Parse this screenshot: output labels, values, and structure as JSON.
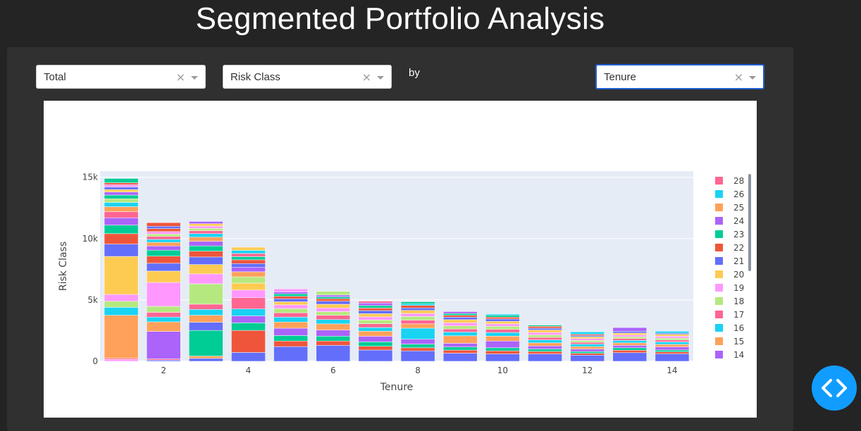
{
  "page": {
    "title": "Segmented Portfolio Analysis",
    "by_label": "by"
  },
  "controls": {
    "metric_dropdown": {
      "value": "Total",
      "clear": "×"
    },
    "segment_dropdown": {
      "value": "Risk Class",
      "clear": "×"
    },
    "groupby_dropdown": {
      "value": "Tenure",
      "clear": "×"
    }
  },
  "chart_data": {
    "type": "bar",
    "stacked": true,
    "xlabel": "Tenure",
    "ylabel": "Risk Class",
    "x": [
      1,
      2,
      3,
      4,
      5,
      6,
      7,
      8,
      9,
      10,
      11,
      12,
      13,
      14
    ],
    "x_ticks": [
      "2",
      "4",
      "6",
      "8",
      "10",
      "12",
      "14"
    ],
    "y_ticks": [
      "0",
      "5k",
      "10k",
      "15k"
    ],
    "ylim": [
      0,
      15500
    ],
    "grid": true,
    "legend_position": "right",
    "legend_entries": [
      {
        "name": "28",
        "color": "#FF6692"
      },
      {
        "name": "26",
        "color": "#19D3F3"
      },
      {
        "name": "25",
        "color": "#FFA15A"
      },
      {
        "name": "24",
        "color": "#AB63FA"
      },
      {
        "name": "23",
        "color": "#00CC96"
      },
      {
        "name": "22",
        "color": "#EF553B"
      },
      {
        "name": "21",
        "color": "#636EFA"
      },
      {
        "name": "20",
        "color": "#FECB52"
      },
      {
        "name": "19",
        "color": "#FF97FF"
      },
      {
        "name": "18",
        "color": "#B6E880"
      },
      {
        "name": "17",
        "color": "#FF6692"
      },
      {
        "name": "16",
        "color": "#19D3F3"
      },
      {
        "name": "15",
        "color": "#FFA15A"
      },
      {
        "name": "14",
        "color": "#AB63FA"
      }
    ],
    "totals": [
      14900,
      11300,
      11400,
      9300,
      5900,
      5700,
      4900,
      4850,
      4050,
      3850,
      2950,
      2400,
      2750,
      2450
    ],
    "segment_palette": [
      "#636EFA",
      "#EF553B",
      "#00CC96",
      "#AB63FA",
      "#FFA15A",
      "#19D3F3",
      "#FF6692",
      "#B6E880",
      "#FF97FF",
      "#FECB52"
    ],
    "segments": [
      [
        {
          "c": 8,
          "v": 150
        },
        {
          "c": 6,
          "v": 100
        },
        {
          "c": 4,
          "v": 3500
        },
        {
          "c": 5,
          "v": 650
        },
        {
          "c": 7,
          "v": 500
        },
        {
          "c": 8,
          "v": 550
        },
        {
          "c": 9,
          "v": 3100
        },
        {
          "c": 0,
          "v": 1000
        },
        {
          "c": 1,
          "v": 850
        },
        {
          "c": 2,
          "v": 700
        },
        {
          "c": 3,
          "v": 600
        },
        {
          "c": 6,
          "v": 500
        },
        {
          "c": 4,
          "v": 400
        },
        {
          "c": 5,
          "v": 350
        },
        {
          "c": 7,
          "v": 300
        },
        {
          "c": 2,
          "v": 300
        },
        {
          "c": 3,
          "v": 250
        },
        {
          "c": 9,
          "v": 200
        },
        {
          "c": 0,
          "v": 200
        },
        {
          "c": 8,
          "v": 200
        },
        {
          "c": 1,
          "v": 150
        },
        {
          "c": 2,
          "v": 350
        }
      ],
      [
        {
          "c": 0,
          "v": 100
        },
        {
          "c": 6,
          "v": 100
        },
        {
          "c": 3,
          "v": 2300
        },
        {
          "c": 4,
          "v": 800
        },
        {
          "c": 5,
          "v": 400
        },
        {
          "c": 6,
          "v": 400
        },
        {
          "c": 7,
          "v": 500
        },
        {
          "c": 8,
          "v": 2000
        },
        {
          "c": 9,
          "v": 950
        },
        {
          "c": 0,
          "v": 650
        },
        {
          "c": 1,
          "v": 600
        },
        {
          "c": 2,
          "v": 500
        },
        {
          "c": 3,
          "v": 350
        },
        {
          "c": 4,
          "v": 300
        },
        {
          "c": 5,
          "v": 250
        },
        {
          "c": 6,
          "v": 250
        },
        {
          "c": 7,
          "v": 200
        },
        {
          "c": 8,
          "v": 200
        },
        {
          "c": 1,
          "v": 250
        },
        {
          "c": 0,
          "v": 200
        },
        {
          "c": 1,
          "v": 300
        }
      ],
      [
        {
          "c": 0,
          "v": 250
        },
        {
          "c": 4,
          "v": 200
        },
        {
          "c": 2,
          "v": 2200
        },
        {
          "c": 0,
          "v": 700
        },
        {
          "c": 4,
          "v": 600
        },
        {
          "c": 5,
          "v": 500
        },
        {
          "c": 6,
          "v": 450
        },
        {
          "c": 7,
          "v": 1750
        },
        {
          "c": 8,
          "v": 850
        },
        {
          "c": 9,
          "v": 800
        },
        {
          "c": 0,
          "v": 650
        },
        {
          "c": 1,
          "v": 500
        },
        {
          "c": 2,
          "v": 450
        },
        {
          "c": 3,
          "v": 400
        },
        {
          "c": 4,
          "v": 350
        },
        {
          "c": 5,
          "v": 300
        },
        {
          "c": 6,
          "v": 250
        },
        {
          "c": 7,
          "v": 200
        },
        {
          "c": 8,
          "v": 200
        },
        {
          "c": 9,
          "v": 200
        },
        {
          "c": 3,
          "v": 200
        }
      ],
      [
        {
          "c": 0,
          "v": 700
        },
        {
          "c": 1,
          "v": 1750
        },
        {
          "c": 2,
          "v": 600
        },
        {
          "c": 3,
          "v": 550
        },
        {
          "c": 5,
          "v": 550
        },
        {
          "c": 6,
          "v": 900
        },
        {
          "c": 8,
          "v": 600
        },
        {
          "c": 9,
          "v": 550
        },
        {
          "c": 7,
          "v": 500
        },
        {
          "c": 4,
          "v": 400
        },
        {
          "c": 3,
          "v": 350
        },
        {
          "c": 0,
          "v": 300
        },
        {
          "c": 1,
          "v": 300
        },
        {
          "c": 2,
          "v": 250
        },
        {
          "c": 6,
          "v": 250
        },
        {
          "c": 5,
          "v": 250
        },
        {
          "c": 9,
          "v": 250
        }
      ],
      [
        {
          "c": 0,
          "v": 1200
        },
        {
          "c": 1,
          "v": 450
        },
        {
          "c": 2,
          "v": 450
        },
        {
          "c": 3,
          "v": 600
        },
        {
          "c": 4,
          "v": 500
        },
        {
          "c": 5,
          "v": 400
        },
        {
          "c": 6,
          "v": 350
        },
        {
          "c": 7,
          "v": 350
        },
        {
          "c": 8,
          "v": 300
        },
        {
          "c": 9,
          "v": 250
        },
        {
          "c": 0,
          "v": 250
        },
        {
          "c": 1,
          "v": 200
        },
        {
          "c": 2,
          "v": 200
        },
        {
          "c": 3,
          "v": 150
        },
        {
          "c": 8,
          "v": 250
        }
      ],
      [
        {
          "c": 0,
          "v": 1300
        },
        {
          "c": 1,
          "v": 350
        },
        {
          "c": 2,
          "v": 400
        },
        {
          "c": 3,
          "v": 500
        },
        {
          "c": 4,
          "v": 500
        },
        {
          "c": 5,
          "v": 350
        },
        {
          "c": 6,
          "v": 350
        },
        {
          "c": 7,
          "v": 300
        },
        {
          "c": 8,
          "v": 300
        },
        {
          "c": 9,
          "v": 300
        },
        {
          "c": 0,
          "v": 250
        },
        {
          "c": 1,
          "v": 200
        },
        {
          "c": 2,
          "v": 150
        },
        {
          "c": 3,
          "v": 150
        },
        {
          "c": 7,
          "v": 300
        }
      ],
      [
        {
          "c": 0,
          "v": 900
        },
        {
          "c": 1,
          "v": 300
        },
        {
          "c": 2,
          "v": 350
        },
        {
          "c": 3,
          "v": 450
        },
        {
          "c": 4,
          "v": 400
        },
        {
          "c": 5,
          "v": 300
        },
        {
          "c": 6,
          "v": 300
        },
        {
          "c": 7,
          "v": 300
        },
        {
          "c": 8,
          "v": 250
        },
        {
          "c": 9,
          "v": 250
        },
        {
          "c": 0,
          "v": 250
        },
        {
          "c": 1,
          "v": 200
        },
        {
          "c": 2,
          "v": 200
        },
        {
          "c": 3,
          "v": 200
        },
        {
          "c": 6,
          "v": 150
        }
      ],
      [
        {
          "c": 0,
          "v": 850
        },
        {
          "c": 1,
          "v": 250
        },
        {
          "c": 2,
          "v": 300
        },
        {
          "c": 3,
          "v": 400
        },
        {
          "c": 5,
          "v": 900
        },
        {
          "c": 4,
          "v": 350
        },
        {
          "c": 6,
          "v": 300
        },
        {
          "c": 7,
          "v": 300
        },
        {
          "c": 8,
          "v": 250
        },
        {
          "c": 9,
          "v": 250
        },
        {
          "c": 0,
          "v": 200
        },
        {
          "c": 1,
          "v": 200
        },
        {
          "c": 5,
          "v": 150
        },
        {
          "c": 2,
          "v": 150
        }
      ],
      [
        {
          "c": 0,
          "v": 650
        },
        {
          "c": 1,
          "v": 250
        },
        {
          "c": 2,
          "v": 250
        },
        {
          "c": 3,
          "v": 300
        },
        {
          "c": 4,
          "v": 600
        },
        {
          "c": 5,
          "v": 300
        },
        {
          "c": 6,
          "v": 250
        },
        {
          "c": 7,
          "v": 250
        },
        {
          "c": 8,
          "v": 250
        },
        {
          "c": 9,
          "v": 250
        },
        {
          "c": 0,
          "v": 200
        },
        {
          "c": 1,
          "v": 150
        },
        {
          "c": 2,
          "v": 150
        },
        {
          "c": 3,
          "v": 150
        }
      ],
      [
        {
          "c": 0,
          "v": 600
        },
        {
          "c": 1,
          "v": 250
        },
        {
          "c": 2,
          "v": 250
        },
        {
          "c": 3,
          "v": 550
        },
        {
          "c": 4,
          "v": 400
        },
        {
          "c": 5,
          "v": 300
        },
        {
          "c": 6,
          "v": 250
        },
        {
          "c": 7,
          "v": 250
        },
        {
          "c": 8,
          "v": 200
        },
        {
          "c": 9,
          "v": 200
        },
        {
          "c": 0,
          "v": 200
        },
        {
          "c": 1,
          "v": 150
        },
        {
          "c": 2,
          "v": 150
        },
        {
          "c": 5,
          "v": 100
        }
      ],
      [
        {
          "c": 0,
          "v": 600
        },
        {
          "c": 1,
          "v": 200
        },
        {
          "c": 2,
          "v": 200
        },
        {
          "c": 3,
          "v": 250
        },
        {
          "c": 4,
          "v": 250
        },
        {
          "c": 5,
          "v": 250
        },
        {
          "c": 6,
          "v": 200
        },
        {
          "c": 7,
          "v": 200
        },
        {
          "c": 8,
          "v": 200
        },
        {
          "c": 9,
          "v": 200
        },
        {
          "c": 0,
          "v": 150
        },
        {
          "c": 1,
          "v": 150
        },
        {
          "c": 2,
          "v": 100
        }
      ],
      [
        {
          "c": 0,
          "v": 500
        },
        {
          "c": 1,
          "v": 150
        },
        {
          "c": 2,
          "v": 150
        },
        {
          "c": 3,
          "v": 200
        },
        {
          "c": 4,
          "v": 200
        },
        {
          "c": 5,
          "v": 200
        },
        {
          "c": 6,
          "v": 150
        },
        {
          "c": 7,
          "v": 150
        },
        {
          "c": 8,
          "v": 150
        },
        {
          "c": 9,
          "v": 150
        },
        {
          "c": 0,
          "v": 100
        },
        {
          "c": 1,
          "v": 100
        },
        {
          "c": 5,
          "v": 200
        }
      ],
      [
        {
          "c": 0,
          "v": 700
        },
        {
          "c": 1,
          "v": 200
        },
        {
          "c": 2,
          "v": 200
        },
        {
          "c": 3,
          "v": 200
        },
        {
          "c": 4,
          "v": 200
        },
        {
          "c": 5,
          "v": 200
        },
        {
          "c": 6,
          "v": 150
        },
        {
          "c": 7,
          "v": 150
        },
        {
          "c": 8,
          "v": 150
        },
        {
          "c": 9,
          "v": 150
        },
        {
          "c": 0,
          "v": 150
        },
        {
          "c": 3,
          "v": 300
        }
      ],
      [
        {
          "c": 0,
          "v": 600
        },
        {
          "c": 1,
          "v": 150
        },
        {
          "c": 2,
          "v": 150
        },
        {
          "c": 3,
          "v": 250
        },
        {
          "c": 4,
          "v": 200
        },
        {
          "c": 5,
          "v": 200
        },
        {
          "c": 6,
          "v": 150
        },
        {
          "c": 7,
          "v": 150
        },
        {
          "c": 8,
          "v": 150
        },
        {
          "c": 9,
          "v": 150
        },
        {
          "c": 0,
          "v": 100
        },
        {
          "c": 5,
          "v": 150
        }
      ]
    ]
  },
  "fab": {
    "icon": "code-icon"
  }
}
